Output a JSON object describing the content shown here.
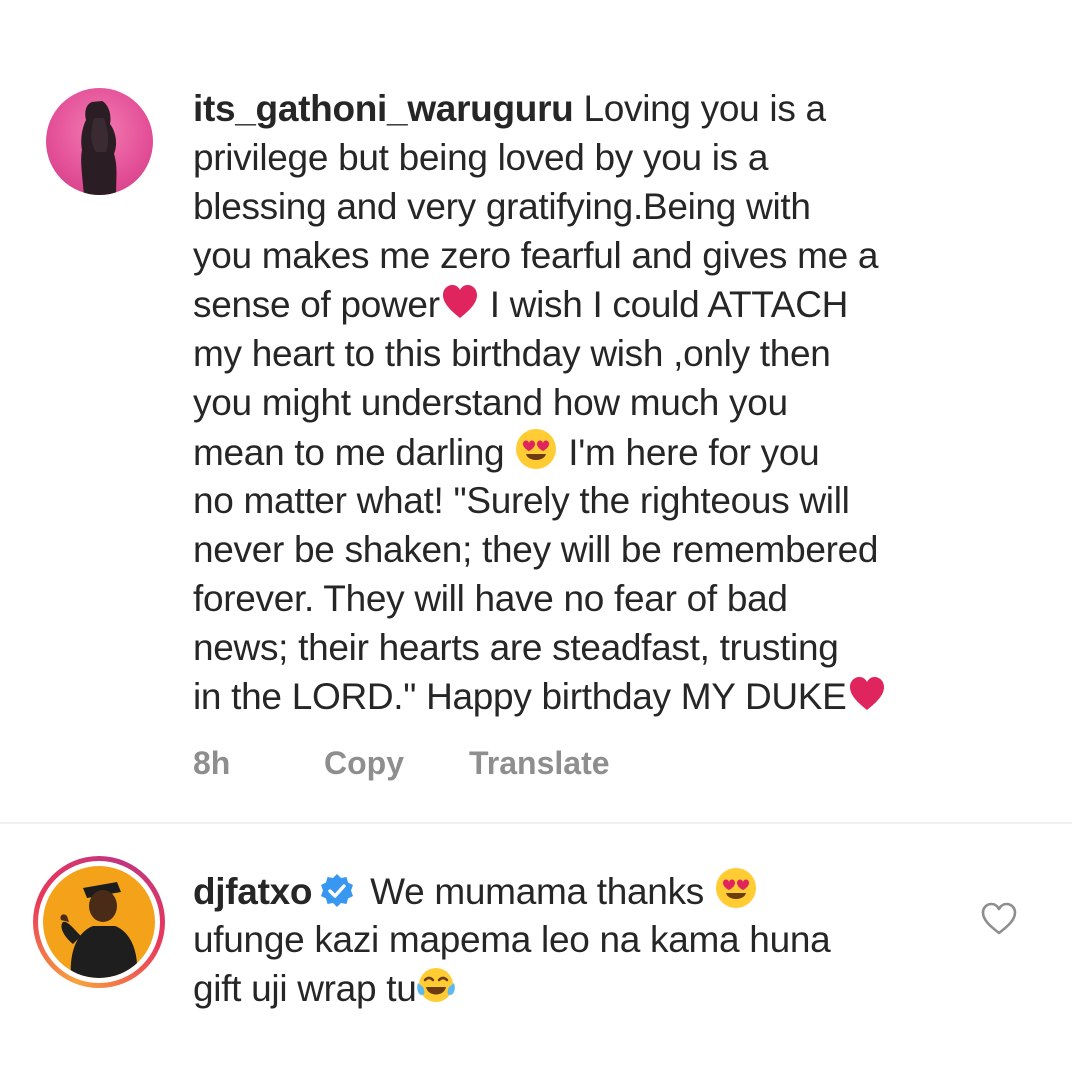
{
  "comment_1": {
    "username": "its_gathoni_waruguru",
    "lines": [
      " Loving you is a",
      "privilege but being loved by you is a",
      "blessing and very gratifying.Being with",
      "you makes me zero fearful and gives me a",
      "sense of power",
      " I wish I could ATTACH",
      "my heart to this birthday wish ,only then",
      "you might understand how much you",
      "mean to me darling ",
      " I'm here for you",
      "no matter what! \"Surely the righteous will",
      "never be shaken; they will be remembered",
      "forever. They will have no fear of bad",
      "news; their hearts are steadfast, trusting",
      "in the LORD.\" Happy birthday MY DUKE"
    ],
    "actions": {
      "time": "8h",
      "copy": "Copy",
      "translate": "Translate"
    }
  },
  "comment_2": {
    "username": "djfatxo",
    "verified": true,
    "lines": [
      " We mumama thanks ",
      "ufunge kazi mapema leo na kama huna",
      "gift uji wrap tu"
    ]
  },
  "icons": {
    "heart_emoji": "red-heart-emoji",
    "heart_eyes_emoji": "smiling-face-heart-eyes-emoji",
    "joy_emoji": "face-tears-of-joy-emoji",
    "verified_badge": "verified-badge-icon",
    "like": "heart-outline-icon"
  },
  "colors": {
    "text": "#262626",
    "secondary": "#8e8e8e",
    "verified": "#3897f0",
    "heart": "#e0245e"
  }
}
